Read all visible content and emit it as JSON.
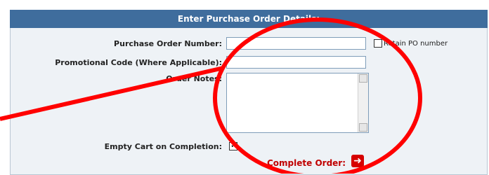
{
  "form": {
    "header_title": "Enter Purchase Order Details:",
    "po_label": "Purchase Order Number:",
    "promo_label": "Promotional Code (Where Applicable):",
    "notes_label": "Order Notes:",
    "empty_cart_label": "Empty Cart on Completion:",
    "retain_label": "Retain PO number",
    "po_value": "",
    "promo_value": "",
    "notes_value": "",
    "complete_label": "Complete Order:"
  },
  "colors": {
    "header_bg": "#3f6d9d",
    "annotation": "#ff0000",
    "complete_text": "#c00000"
  },
  "icons": {
    "complete_arrow": "arrow-right-icon"
  }
}
